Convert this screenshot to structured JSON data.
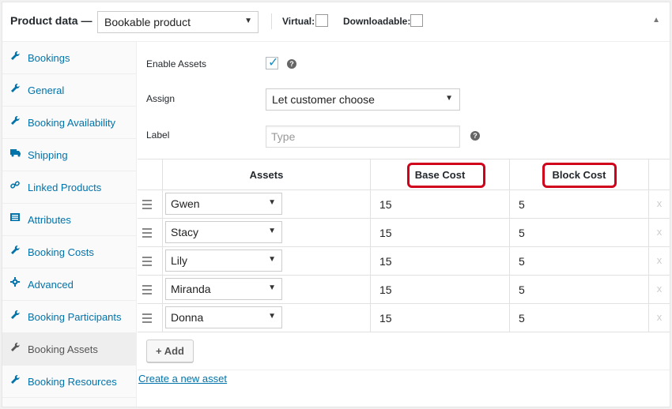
{
  "header": {
    "title": "Product data —",
    "product_type": "Bookable product",
    "virtual_label": "Virtual:",
    "downloadable_label": "Downloadable:"
  },
  "sidebar": {
    "items": [
      {
        "label": "Bookings",
        "icon": "wrench-icon"
      },
      {
        "label": "General",
        "icon": "wrench-icon"
      },
      {
        "label": "Booking Availability",
        "icon": "wrench-icon"
      },
      {
        "label": "Shipping",
        "icon": "truck-icon"
      },
      {
        "label": "Linked Products",
        "icon": "link-icon"
      },
      {
        "label": "Attributes",
        "icon": "list-icon"
      },
      {
        "label": "Booking Costs",
        "icon": "wrench-icon"
      },
      {
        "label": "Advanced",
        "icon": "gear-icon"
      },
      {
        "label": "Booking Participants",
        "icon": "wrench-icon"
      },
      {
        "label": "Booking Assets",
        "icon": "wrench-icon",
        "active": true
      },
      {
        "label": "Booking Resources",
        "icon": "wrench-icon"
      }
    ]
  },
  "form": {
    "enable_assets_label": "Enable Assets",
    "enable_assets_checked": true,
    "assign_label": "Assign",
    "assign_value": "Let customer choose",
    "label_label": "Label",
    "label_placeholder": "Type"
  },
  "table": {
    "headers": {
      "assets": "Assets",
      "base_cost": "Base Cost",
      "block_cost": "Block Cost"
    },
    "rows": [
      {
        "asset": "Gwen",
        "base_cost": "15",
        "block_cost": "5",
        "remove": "x"
      },
      {
        "asset": "Stacy",
        "base_cost": "15",
        "block_cost": "5",
        "remove": "x"
      },
      {
        "asset": "Lily",
        "base_cost": "15",
        "block_cost": "5",
        "remove": "x"
      },
      {
        "asset": "Miranda",
        "base_cost": "15",
        "block_cost": "5",
        "remove": "x"
      },
      {
        "asset": "Donna",
        "base_cost": "15",
        "block_cost": "5",
        "remove": "x"
      }
    ],
    "highlight_color": "#d0021b"
  },
  "actions": {
    "add_label": "+ Add",
    "create_link": "Create a new asset"
  },
  "colors": {
    "link": "#0073aa",
    "check": "#1e8cbe"
  }
}
